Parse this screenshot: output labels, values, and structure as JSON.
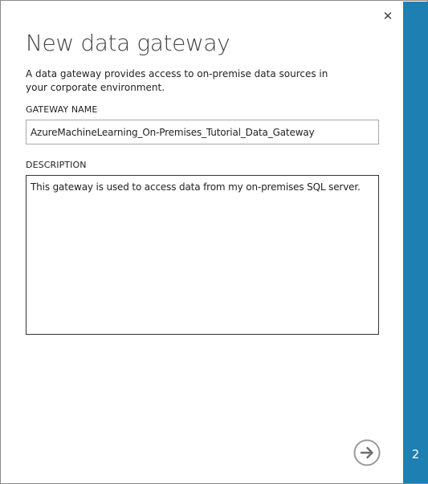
{
  "dialog": {
    "title": "New data gateway",
    "description": "A data gateway provides access to on-premise data sources in your corporate environment.",
    "close_icon": "close-icon",
    "next_icon": "arrow-right-circle-icon"
  },
  "fields": {
    "gateway_name": {
      "label": "GATEWAY NAME",
      "value": "AzureMachineLearning_On-Premises_Tutorial_Data_Gateway"
    },
    "description": {
      "label": "DESCRIPTION",
      "value": "This gateway is used to access data from my on-premises SQL server."
    }
  },
  "wizard": {
    "step": "2"
  },
  "colors": {
    "side_panel": "#1d7fb2",
    "title": "#444444"
  }
}
